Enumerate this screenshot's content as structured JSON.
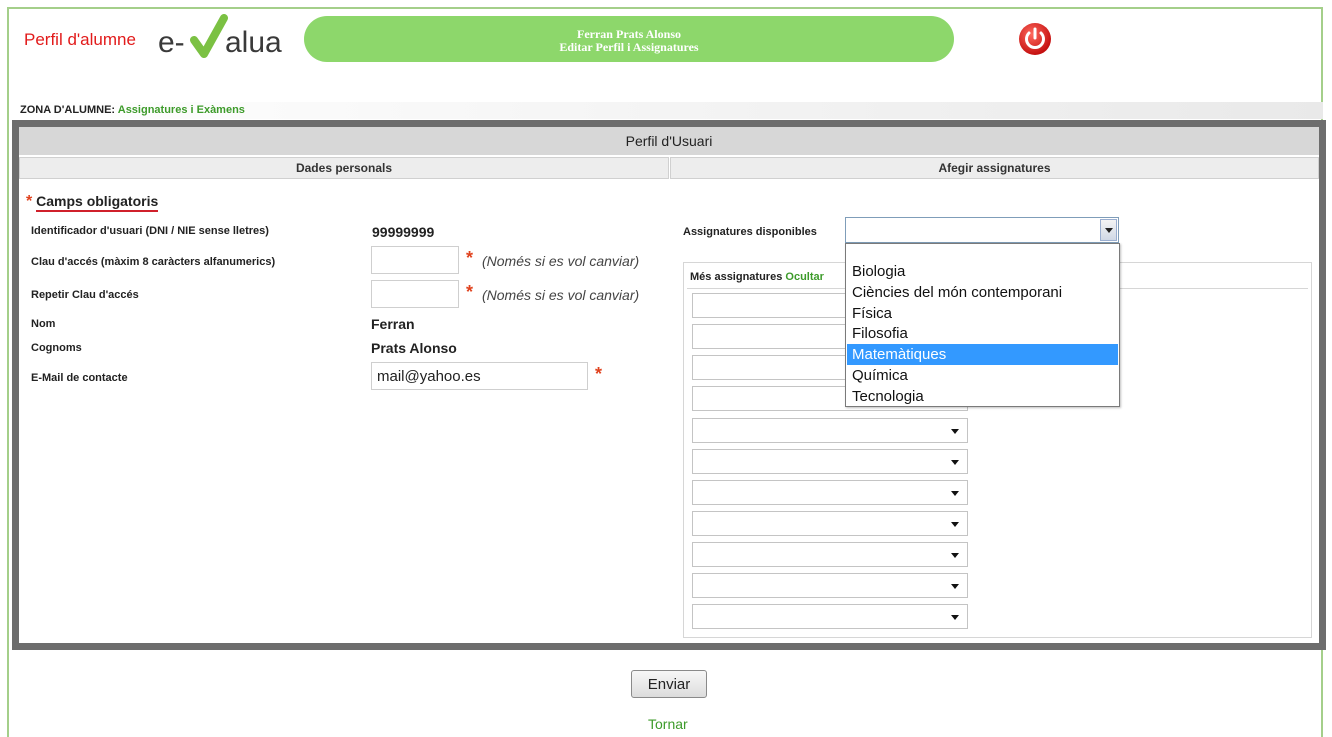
{
  "header": {
    "brand_label": "Perfil d'alumne",
    "logo_left": "e-",
    "logo_right": "alua",
    "user_name": "Ferran Prats Alonso",
    "page_subtitle": "Editar Perfil i Assignatures",
    "power_icon": "power-icon",
    "accent_red": "#e21b1b",
    "accent_green": "#8dd76b"
  },
  "zona": {
    "label": "ZONA D'ALUMNE:",
    "link": "Assignatures i Exàmens"
  },
  "panel": {
    "title": "Perfil d'Usuari",
    "tab_personal": "Dades personals",
    "tab_subjects": "Afegir assignatures"
  },
  "form": {
    "required_mark": "*",
    "required_title": "Camps obligatoris",
    "user_id_label": "Identificador d'usuari (DNI / NIE sense lletres)",
    "user_id_value": "99999999",
    "password_label": "Clau d'accés (màxim 8 caràcters alfanumerics)",
    "password_value": "",
    "repeat_password_label": "Repetir Clau d'accés",
    "repeat_password_value": "",
    "optional_hint": "(Només si es vol canviar)",
    "name_label": "Nom",
    "name_value": "Ferran",
    "surname_label": "Cognoms",
    "surname_value": "Prats Alonso",
    "email_label": "E-Mail de contacte",
    "email_value": "mail@yahoo.es"
  },
  "subjects": {
    "available_label": "Assignatures disponibles",
    "selected_value": "",
    "options": [
      "Biologia",
      "Ciències del món contemporani",
      "Física",
      "Filosofia",
      "Matemàtiques",
      "Química",
      "Tecnologia"
    ],
    "highlighted": "Matemàtiques",
    "more_label": "Més assignatures",
    "hide_link": "Ocultar",
    "extra_selects": [
      "",
      "",
      "",
      "",
      "",
      "",
      "",
      "",
      "",
      "",
      ""
    ]
  },
  "actions": {
    "submit": "Enviar",
    "back": "Tornar"
  }
}
